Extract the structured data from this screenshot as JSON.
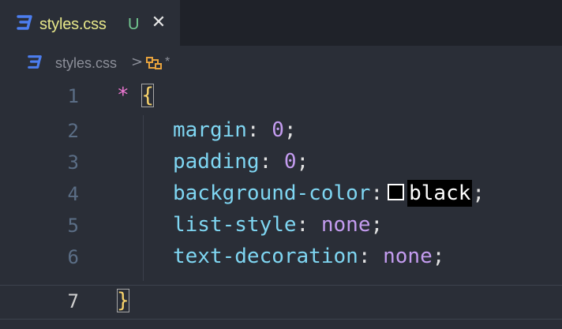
{
  "tab": {
    "filename": "styles.css",
    "status": "U",
    "close_glyph": "✕",
    "icon": "css-icon"
  },
  "breadcrumb": {
    "file": "styles.css",
    "separator": ">",
    "symbol": "*",
    "file_icon": "css-icon",
    "symbol_icon": "css-selector-icon"
  },
  "editor": {
    "lines": [
      {
        "number": "1",
        "selector": "*",
        "brace": "{"
      },
      {
        "number": "2",
        "property": "margin",
        "colon": ":",
        "value": "0",
        "semi": ";"
      },
      {
        "number": "3",
        "property": "padding",
        "colon": ":",
        "value": "0",
        "semi": ";"
      },
      {
        "number": "4",
        "property": "background-color",
        "colon": ":",
        "value": "black",
        "semi": ";"
      },
      {
        "number": "5",
        "property": "list-style",
        "colon": ":",
        "value": "none",
        "semi": ";"
      },
      {
        "number": "6",
        "property": "text-decoration",
        "colon": ":",
        "value": "none",
        "semi": ";"
      },
      {
        "number": "7",
        "brace": "}"
      }
    ],
    "active_line": "7"
  },
  "colors": {
    "background": "#2a2e37",
    "tab_label": "#e8e88a",
    "status_untracked": "#73c991",
    "property": "#7fd6f2",
    "value": "#c49cf0",
    "selector": "#f078d4",
    "brace": "#f7d26b",
    "css_icon": "#4c7ef0"
  }
}
